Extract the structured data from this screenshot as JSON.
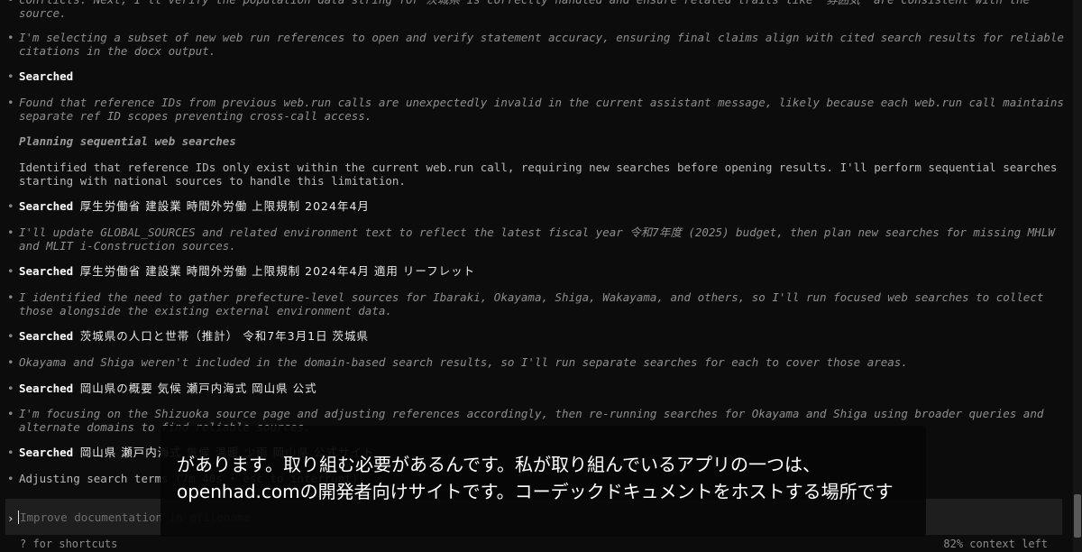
{
  "log": [
    {
      "kind": "note",
      "top": 0,
      "text": "conflicts. Next, I'll verify the population data string for 茨城県 is correctly handled and ensure related traits like \"雰囲気\" are consistent with the source."
    },
    {
      "kind": "note",
      "text": "I'm selecting a subset of new web run references to open and verify statement accuracy, ensuring final claims align with cited search results for reliable citations in the docx output."
    },
    {
      "kind": "search",
      "label": "Searched",
      "query": ""
    },
    {
      "kind": "note",
      "text": "Found that reference IDs from previous web.run calls are unexpectedly invalid in the current assistant message, likely because each web.run call maintains separate ref ID scopes preventing cross-call access."
    },
    {
      "kind": "heading",
      "text": "Planning sequential web searches"
    },
    {
      "kind": "plain",
      "text": "Identified that reference IDs only exist within the current web.run call, requiring new searches before opening results. I'll perform sequential searches starting with national sources to handle this limitation."
    },
    {
      "kind": "search",
      "label": "Searched",
      "query": "厚生労働省 建設業 時間外労働 上限規制 2024年4月"
    },
    {
      "kind": "note",
      "text": "I'll update GLOBAL_SOURCES and related environment text to reflect the latest fiscal year 令和7年度 (2025) budget, then plan new searches for missing MHLW and MLIT i-Construction sources."
    },
    {
      "kind": "search",
      "label": "Searched",
      "query": "厚生労働省 建設業 時間外労働 上限規制 2024年4月 適用 リーフレット"
    },
    {
      "kind": "note",
      "text": "I identified the need to gather prefecture-level sources for Ibaraki, Okayama, Shiga, Wakayama, and others, so I'll run focused web searches to collect those alongside the existing external environment data."
    },
    {
      "kind": "search",
      "label": "Searched",
      "query": "茨城県の人口と世帯（推計） 令和7年3月1日 茨城県"
    },
    {
      "kind": "note",
      "text": "Okayama and Shiga weren't included in the domain-based search results, so I'll run separate searches for each to cover those areas."
    },
    {
      "kind": "search",
      "label": "Searched",
      "query": "岡山県の概要 気候 瀬戸内海式 岡山県 公式"
    },
    {
      "kind": "note",
      "text": "I'm focusing on the Shizuoka source page and adjusting references accordingly, then re-running searches for Okayama and Shiga using broader queries and alternate domains to find reliable sources."
    },
    {
      "kind": "search",
      "label": "Searched",
      "query": "岡山県 瀬戸内海式 気候 温暖 少雨 岡山県 公式サイト"
    },
    {
      "kind": "plain",
      "text": "Adjusting search terms (7m 40s • esc to interrupt)"
    }
  ],
  "composer": {
    "prompt_symbol": "›",
    "placeholder": "Improve documentation in @filename",
    "value": ""
  },
  "footer": {
    "shortcuts_hint": "? for shortcuts",
    "context_left": "82% context left"
  },
  "subtitle": {
    "lines": [
      "があります。取り組む必要があるんです。私が取り組んでいるアプリの一つは、",
      "openhad.comの開発者向けサイトです。コーデックドキュメントをホストする場所です"
    ]
  }
}
